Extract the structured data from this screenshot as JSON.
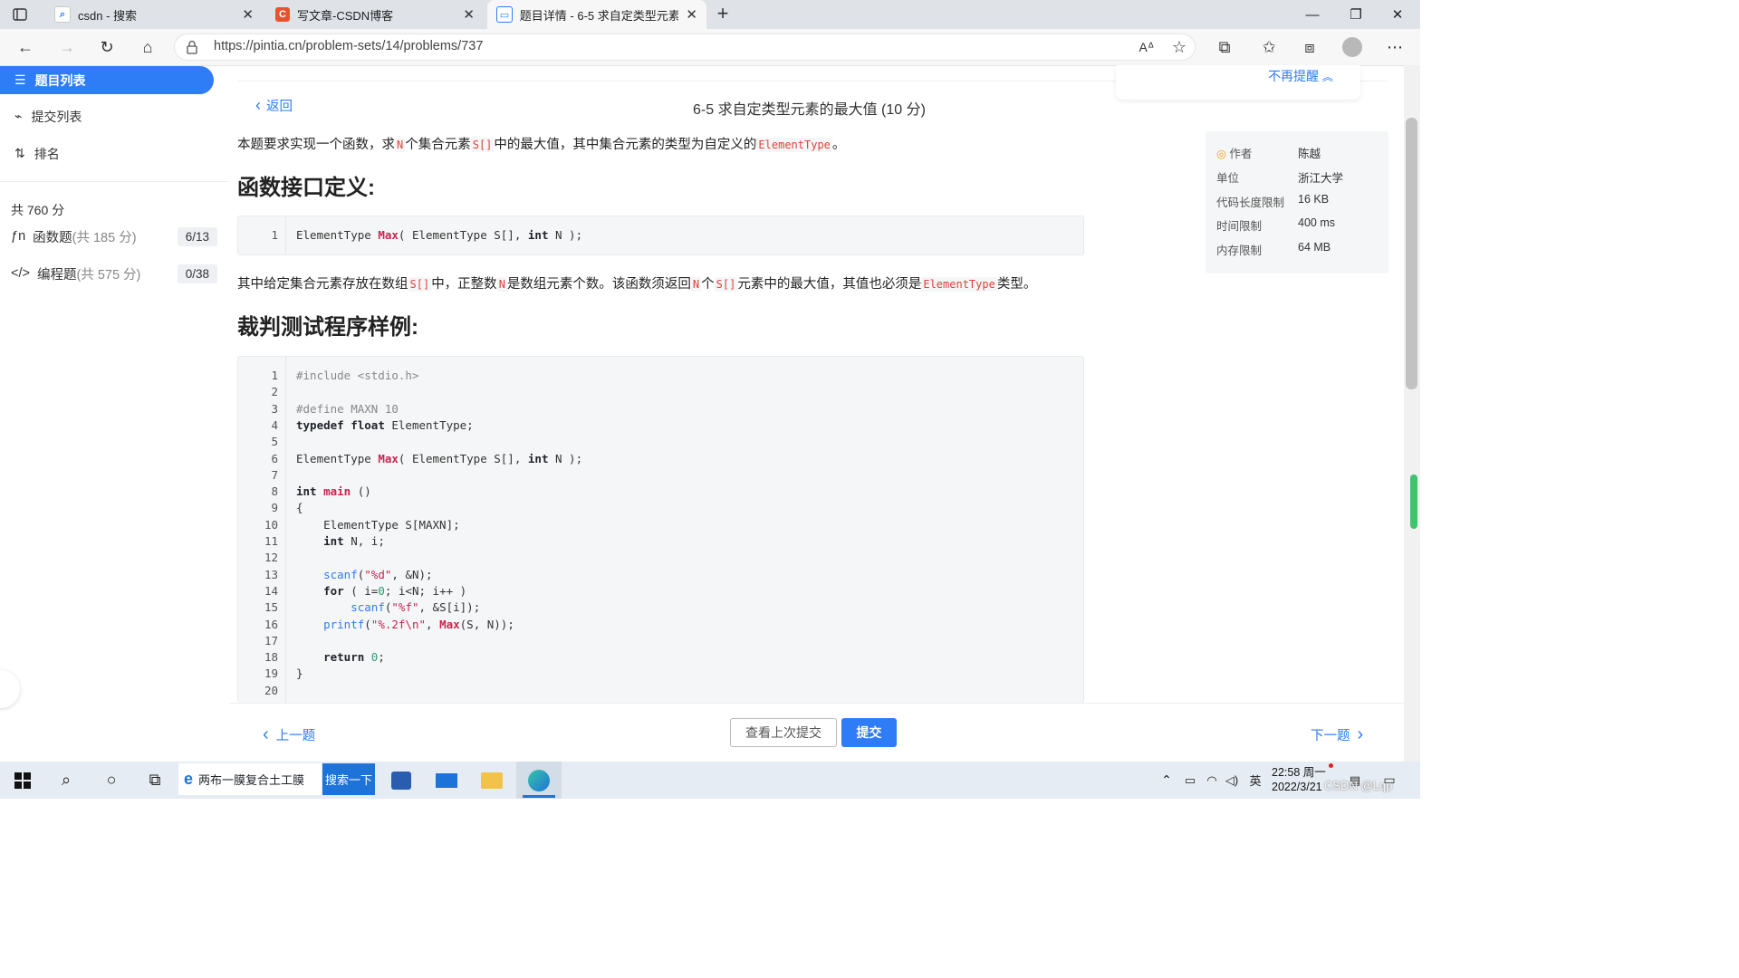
{
  "browser": {
    "tabs": [
      {
        "label": "csdn - 搜索",
        "icon": "search-favicon"
      },
      {
        "label": "写文章-CSDN博客",
        "icon": "csdn-favicon"
      },
      {
        "label": "题目详情 - 6-5 求自定类型元素的",
        "icon": "pta-favicon"
      }
    ],
    "url": "https://pintia.cn/problem-sets/14/problems/737"
  },
  "sidebar": {
    "items": [
      {
        "label": "题目列表"
      },
      {
        "label": "提交列表"
      },
      {
        "label": "排名"
      }
    ],
    "total_score": "共 760 分",
    "categories": [
      {
        "label": "函数题",
        "sub": "(共 185 分)",
        "count": "6/13"
      },
      {
        "label": "编程题",
        "sub": "(共 575 分)",
        "count": "0/38"
      }
    ]
  },
  "problem": {
    "back_label": "返回",
    "title": "6-5 求自定类型元素的最大值 (10 分)",
    "intro": {
      "t1": "本题要求实现一个函数，求",
      "c1": "N",
      "t2": "个集合元素",
      "c2": "S[]",
      "t3": "中的最大值，其中集合元素的类型为自定义的",
      "c3": "ElementType",
      "t4": "。"
    },
    "h_interface": "函数接口定义:",
    "interface_code": [
      {
        "n": "1",
        "text": "ElementType Max( ElementType S[], int N );"
      }
    ],
    "desc": {
      "t1": "其中给定集合元素存放在数组",
      "c1": "S[]",
      "t2": "中，正整数",
      "c2": "N",
      "t3": "是数组元素个数。该函数须返回",
      "c3": "N",
      "t4": "个",
      "c4": "S[]",
      "t5": "元素中的最大值，其值也必须是",
      "c5": "ElementType",
      "t6": "类型。"
    },
    "h_sample": "裁判测试程序样例:",
    "sample_code": [
      {
        "n": "1",
        "text": "#include <stdio.h>"
      },
      {
        "n": "2",
        "text": ""
      },
      {
        "n": "3",
        "text": "#define MAXN 10"
      },
      {
        "n": "4",
        "text": "typedef float ElementType;"
      },
      {
        "n": "5",
        "text": ""
      },
      {
        "n": "6",
        "text": "ElementType Max( ElementType S[], int N );"
      },
      {
        "n": "7",
        "text": ""
      },
      {
        "n": "8",
        "text": "int main ()"
      },
      {
        "n": "9",
        "text": "{"
      },
      {
        "n": "10",
        "text": "    ElementType S[MAXN];"
      },
      {
        "n": "11",
        "text": "    int N, i;"
      },
      {
        "n": "12",
        "text": ""
      },
      {
        "n": "13",
        "text": "    scanf(\"%d\", &N);"
      },
      {
        "n": "14",
        "text": "    for ( i=0; i<N; i++ )"
      },
      {
        "n": "15",
        "text": "        scanf(\"%f\", &S[i]);"
      },
      {
        "n": "16",
        "text": "    printf(\"%.2f\\n\", Max(S, N));"
      },
      {
        "n": "17",
        "text": ""
      },
      {
        "n": "18",
        "text": "    return 0;"
      },
      {
        "n": "19",
        "text": "}"
      },
      {
        "n": "20",
        "text": ""
      }
    ]
  },
  "info": {
    "rows": [
      {
        "k": "作者",
        "v": "陈越"
      },
      {
        "k": "单位",
        "v": "浙江大学"
      },
      {
        "k": "代码长度限制",
        "v": "16 KB"
      },
      {
        "k": "时间限制",
        "v": "400 ms"
      },
      {
        "k": "内存限制",
        "v": "64 MB"
      }
    ],
    "remind": "不再提醒"
  },
  "footer": {
    "prev": "上一题",
    "view_last": "查看上次提交",
    "submit": "提交",
    "next": "下一题"
  },
  "taskbar": {
    "search_text": "两布一膜复合土工膜",
    "search_btn": "搜索一下",
    "ime": "英",
    "time": "22:58 周一",
    "date": "2022/3/21",
    "watermark": "CSDN @Lqp"
  },
  "colors": {
    "accent": "#2e7cf6",
    "code_red": "#e0413b"
  }
}
